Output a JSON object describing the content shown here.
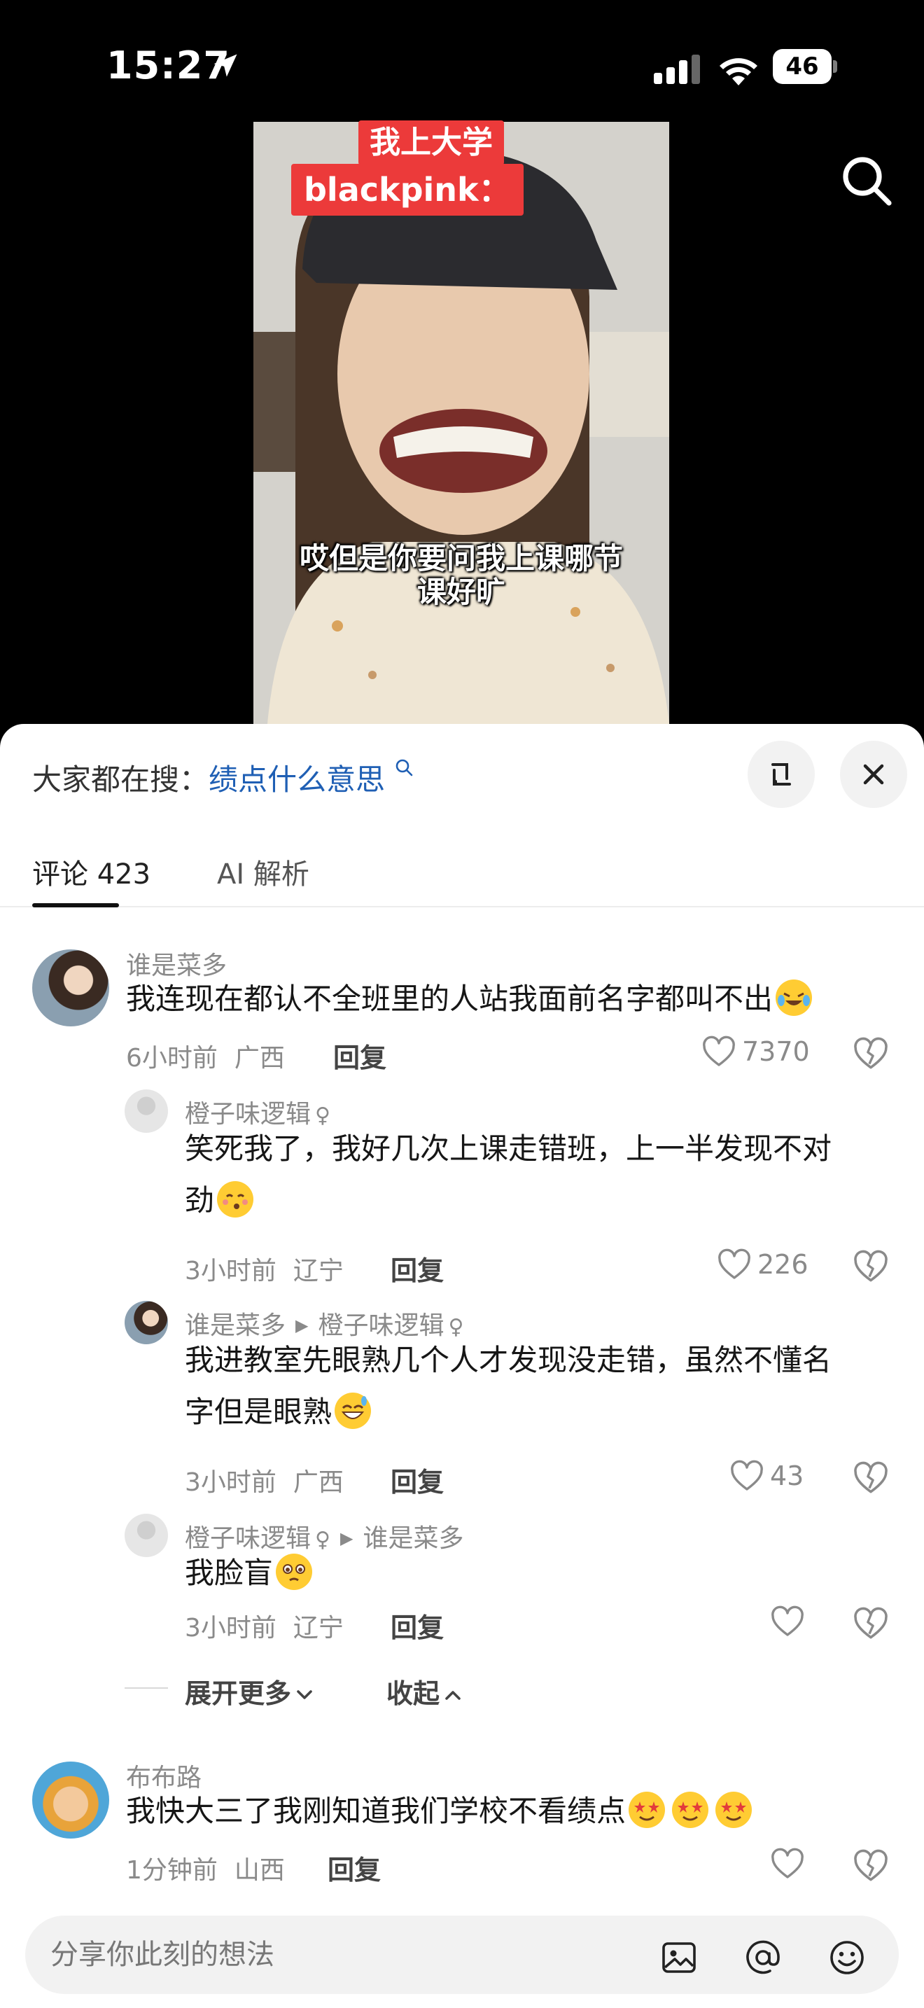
{
  "status_bar": {
    "time": "15:27",
    "battery": "46"
  },
  "video": {
    "title_line1": "我上大学",
    "title_line2": "blackpink：",
    "subtitle_line1": "哎但是你要问我上课哪节",
    "subtitle_line2": "课好旷"
  },
  "sheet": {
    "hot_search_label": "大家都在搜：",
    "hot_search_keyword": "绩点什么意思",
    "tabs": [
      {
        "label": "评论 423"
      },
      {
        "label": "AI 解析"
      }
    ]
  },
  "comments": [
    {
      "user": "谁是菜多",
      "text": "我连现在都认不全班里的人站我面前名字都叫不出",
      "time": "6小时前",
      "location": "广西",
      "reply_label": "回复",
      "likes": "7370",
      "replies": [
        {
          "user": "橙子味逻辑",
          "text_line1": "笑死我了，我好几次上课走错班，上一半发现不对",
          "text_line2": "劲",
          "time": "3小时前",
          "location": "辽宁",
          "reply_label": "回复",
          "likes": "226"
        },
        {
          "user": "谁是菜多",
          "reply_to": "橙子味逻辑",
          "text_line1": "我进教室先眼熟几个人才发现没走错，虽然不懂名",
          "text_line2": "字但是眼熟",
          "time": "3小时前",
          "location": "广西",
          "reply_label": "回复",
          "likes": "43"
        },
        {
          "user": "橙子味逻辑",
          "reply_to": "谁是菜多",
          "text_line1": "我脸盲",
          "time": "3小时前",
          "location": "辽宁",
          "reply_label": "回复",
          "likes": ""
        }
      ],
      "expand_more": "展开更多",
      "collapse": "收起"
    },
    {
      "user": "布布路",
      "text": "我快大三了我刚知道我们学校不看绩点",
      "time": "1分钟前",
      "location": "山西",
      "reply_label": "回复",
      "likes": ""
    }
  ],
  "input": {
    "placeholder": "分享你此刻的想法"
  },
  "icons": {
    "location_arrow": "location-arrow-icon",
    "search": "search-icon",
    "expand": "expand-icon",
    "close": "close-icon",
    "heart": "heart-icon",
    "dislike": "broken-heart-icon",
    "image": "image-icon",
    "at": "at-icon",
    "emoji": "emoji-icon"
  },
  "colors": {
    "accent_link": "#1f5fb4",
    "title_red": "#ec3a3a"
  }
}
